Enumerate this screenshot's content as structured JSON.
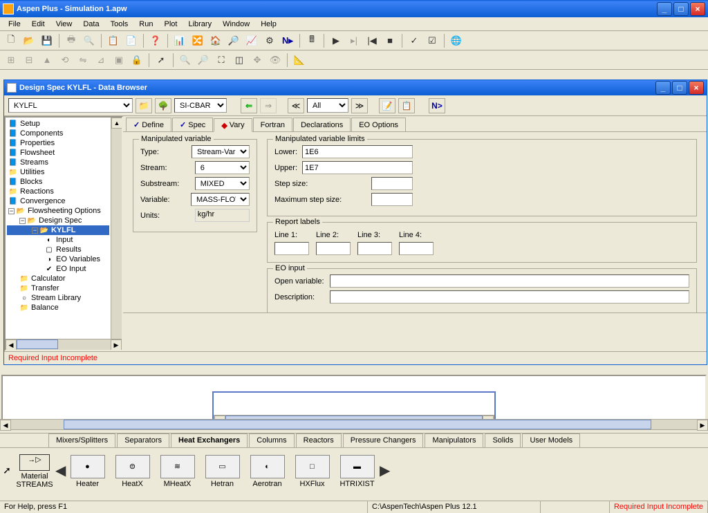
{
  "window": {
    "title": "Aspen Plus - Simulation 1.apw"
  },
  "menu": [
    "File",
    "Edit",
    "View",
    "Data",
    "Tools",
    "Run",
    "Plot",
    "Library",
    "Window",
    "Help"
  ],
  "subwindow": {
    "title": "Design Spec KYLFL - Data Browser"
  },
  "nav": {
    "object": "KYLFL",
    "units": "SI-CBAR",
    "filter": "All",
    "next": "N>"
  },
  "tree": [
    {
      "l": 0,
      "t": "Setup",
      "ic": "📘"
    },
    {
      "l": 0,
      "t": "Components",
      "ic": "📘"
    },
    {
      "l": 0,
      "t": "Properties",
      "ic": "📘"
    },
    {
      "l": 0,
      "t": "Flowsheet",
      "ic": "📘"
    },
    {
      "l": 0,
      "t": "Streams",
      "ic": "📘"
    },
    {
      "l": 0,
      "t": "Utilities",
      "ic": "📁"
    },
    {
      "l": 0,
      "t": "Blocks",
      "ic": "📘"
    },
    {
      "l": 0,
      "t": "Reactions",
      "ic": "📁"
    },
    {
      "l": 0,
      "t": "Convergence",
      "ic": "📘"
    },
    {
      "l": 0,
      "t": "Flowsheeting Options",
      "ic": "📂",
      "exp": "−"
    },
    {
      "l": 1,
      "t": "Design Spec",
      "ic": "📂",
      "exp": "−"
    },
    {
      "l": 2,
      "t": "KYLFL",
      "ic": "📂",
      "exp": "−",
      "sel": true,
      "bold": true
    },
    {
      "l": 3,
      "t": "Input",
      "ic": "◐"
    },
    {
      "l": 3,
      "t": "Results",
      "ic": "▢"
    },
    {
      "l": 3,
      "t": "EO Variables",
      "ic": "◑"
    },
    {
      "l": 3,
      "t": "EO Input",
      "ic": "✔"
    },
    {
      "l": 1,
      "t": "Calculator",
      "ic": "📁"
    },
    {
      "l": 1,
      "t": "Transfer",
      "ic": "📁"
    },
    {
      "l": 1,
      "t": "Stream Library",
      "ic": "○"
    },
    {
      "l": 1,
      "t": "Balance",
      "ic": "📁"
    }
  ],
  "tabs": [
    {
      "label": "Define",
      "ic": "chk"
    },
    {
      "label": "Spec",
      "ic": "chk"
    },
    {
      "label": "Vary",
      "ic": "warn",
      "active": true
    },
    {
      "label": "Fortran"
    },
    {
      "label": "Declarations"
    },
    {
      "label": "EO Options"
    }
  ],
  "form": {
    "manip_var_title": "Manipulated variable",
    "type_label": "Type:",
    "type_value": "Stream-Var",
    "stream_label": "Stream:",
    "stream_value": "6",
    "sub_label": "Substream:",
    "sub_value": "MIXED",
    "var_label": "Variable:",
    "var_value": "MASS-FLOW",
    "units_label": "Units:",
    "units_value": "kg/hr",
    "limits_title": "Manipulated variable limits",
    "lower_label": "Lower:",
    "lower_value": "1E6",
    "upper_label": "Upper:",
    "upper_value": "1E7",
    "step_label": "Step size:",
    "maxstep_label": "Maximum step size:",
    "report_title": "Report labels",
    "line1": "Line 1:",
    "line2": "Line 2:",
    "line3": "Line 3:",
    "line4": "Line 4:",
    "eo_title": "EO input",
    "openvar_label": "Open variable:",
    "desc_label": "Description:"
  },
  "status_msg": "Required Input Incomplete",
  "palette_tabs": [
    "Mixers/Splitters",
    "Separators",
    "Heat Exchangers",
    "Columns",
    "Reactors",
    "Pressure Changers",
    "Manipulators",
    "Solids",
    "User Models"
  ],
  "palette_active": 2,
  "palette_items": [
    "Heater",
    "HeatX",
    "MHeatX",
    "Hetran",
    "Aerotran",
    "HXFlux",
    "HTRIXIST"
  ],
  "palette_stream": {
    "label1": "Material",
    "label2": "STREAMS"
  },
  "statusbar": {
    "help": "For Help, press F1",
    "path": "C:\\AspenTech\\Aspen Plus 12.1",
    "req": "Required Input Incomplete"
  }
}
